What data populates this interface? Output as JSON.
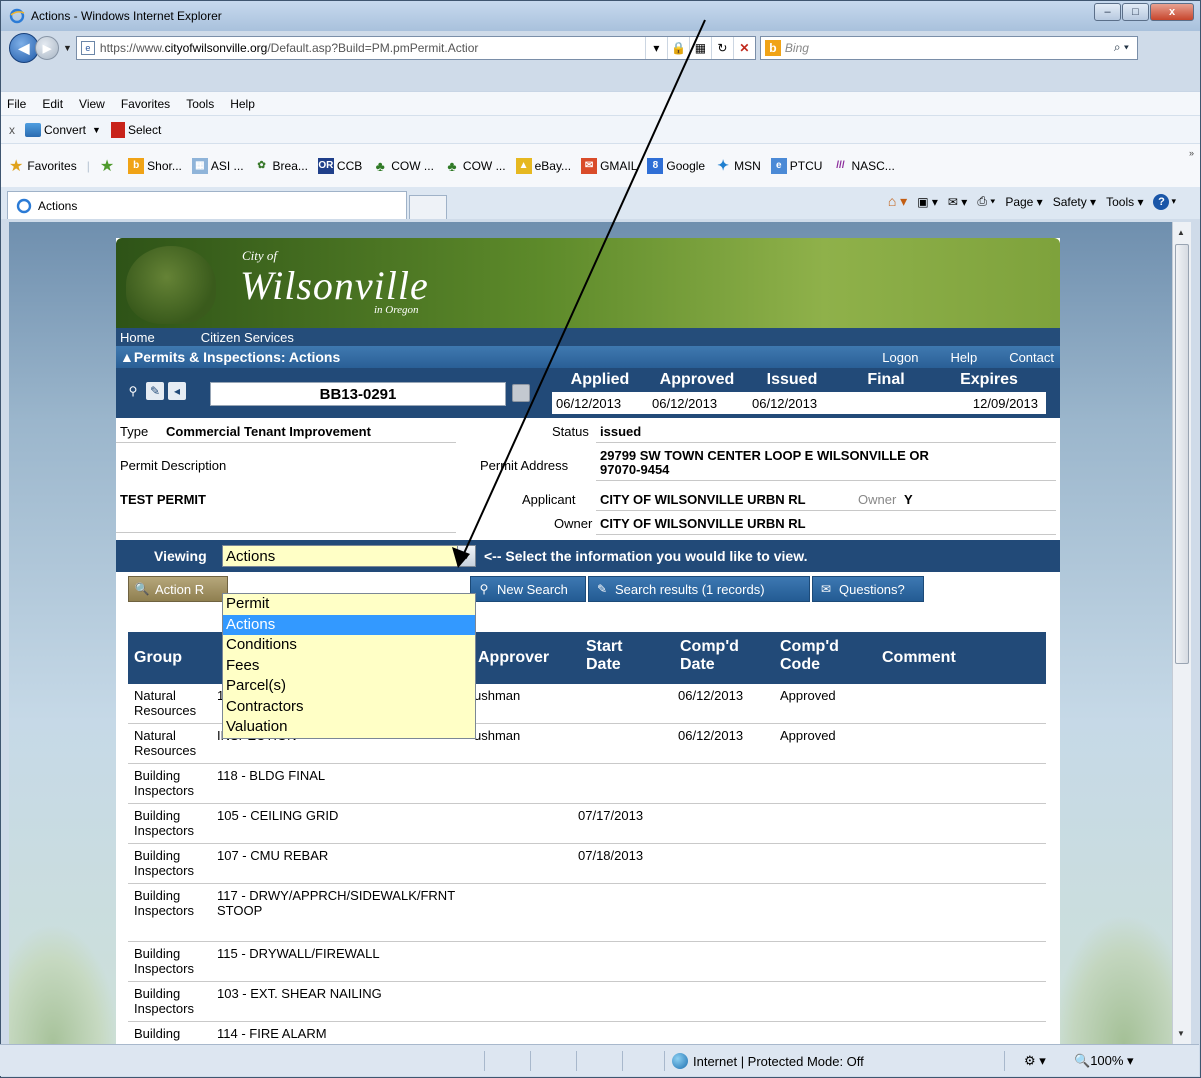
{
  "window": {
    "title": "Actions - Windows Internet Explorer",
    "min": "–",
    "max": "□",
    "close": "x"
  },
  "address": {
    "prefix": "https://www.",
    "domain": "cityofwilsonville.org",
    "path": "/Default.asp?Build=PM.pmPermit.Actior"
  },
  "search": {
    "placeholder": "Bing"
  },
  "menu": [
    "File",
    "Edit",
    "View",
    "Favorites",
    "Tools",
    "Help"
  ],
  "toolbar": {
    "close": "x",
    "convert": "Convert",
    "select": "Select"
  },
  "favorites": {
    "label": "Favorites",
    "items": [
      "Shor...",
      "ASI ...",
      "Brea...",
      "CCB",
      "COW ...",
      "COW ...",
      "eBay...",
      "GMAIL",
      "Google",
      "MSN",
      "PTCU",
      "NASC..."
    ]
  },
  "tab": {
    "label": "Actions"
  },
  "command": {
    "page": "Page ▾",
    "safety": "Safety ▾",
    "tools": "Tools ▾"
  },
  "site": {
    "city_of": "City of",
    "name": "Wilsonville",
    "in_oregon": "in Oregon",
    "nav": [
      "Home",
      "Citizen Services"
    ],
    "section": "▲Permits & Inspections: Actions",
    "links": [
      "Logon",
      "Help",
      "Contact"
    ]
  },
  "permit": {
    "number": "BB13-0291",
    "date_heads": [
      "Applied",
      "Approved",
      "Issued",
      "Final",
      "Expires"
    ],
    "date_vals": [
      "06/12/2013",
      "06/12/2013",
      "06/12/2013",
      "",
      "12/09/2013"
    ],
    "type_label": "Type",
    "type": "Commercial Tenant Improvement",
    "status_label": "Status",
    "status": "issued",
    "desc_label": "Permit Description",
    "address_label": "Permit Address",
    "address_l1": "29799 SW TOWN CENTER LOOP E WILSONVILLE OR",
    "address_l2": "97070-9454",
    "description": "TEST PERMIT",
    "applicant_label": "Applicant",
    "applicant": "CITY OF WILSONVILLE URBN RL",
    "owner_flag_label": "Owner",
    "owner_flag": "Y",
    "owner_label": "Owner",
    "owner": "CITY OF WILSONVILLE URBN RL"
  },
  "viewing": {
    "label": "Viewing",
    "selected": "Actions",
    "hint": "<-- Select the information you would like to view.",
    "options": [
      "Permit",
      "Actions",
      "Conditions",
      "Fees",
      "Parcel(s)",
      "Contractors",
      "Valuation"
    ],
    "selected_index": 1
  },
  "buttons": {
    "action": "Action R",
    "new_search": "New Search",
    "results": "Search results (1 records)",
    "questions": "Questions?"
  },
  "table": {
    "headers": [
      "Group",
      "Approver",
      "Start Date",
      "Comp'd Date",
      "Comp'd Code",
      "Comment"
    ],
    "rows": [
      {
        "group": "Natural Resources",
        "action": "1",
        "approver": "ushman",
        "start": "",
        "comp": "06/12/2013",
        "code": "Approved"
      },
      {
        "group": "Natural Resources",
        "action": "INSPECTION",
        "approver": "ushman",
        "start": "",
        "comp": "06/12/2013",
        "code": "Approved"
      },
      {
        "group": "Building Inspectors",
        "action": "118 - BLDG FINAL",
        "approver": "",
        "start": "",
        "comp": "",
        "code": ""
      },
      {
        "group": "Building Inspectors",
        "action": "105 - CEILING GRID",
        "approver": "",
        "start": "07/17/2013",
        "comp": "",
        "code": ""
      },
      {
        "group": "Building Inspectors",
        "action": "107 - CMU REBAR",
        "approver": "",
        "start": "07/18/2013",
        "comp": "",
        "code": ""
      },
      {
        "group": "Building Inspectors",
        "action": "117 - DRWY/APPRCH/SIDEWALK/FRNT STOOP",
        "approver": "",
        "start": "",
        "comp": "",
        "code": ""
      },
      {
        "group": "Building Inspectors",
        "action": "115 - DRYWALL/FIREWALL",
        "approver": "",
        "start": "",
        "comp": "",
        "code": ""
      },
      {
        "group": "Building Inspectors",
        "action": "103 - EXT. SHEAR NAILING",
        "approver": "",
        "start": "",
        "comp": "",
        "code": ""
      },
      {
        "group": "Building",
        "action": "114 - FIRE ALARM",
        "approver": "",
        "start": "",
        "comp": "",
        "code": ""
      }
    ]
  },
  "status": {
    "zone": "Internet | Protected Mode: Off",
    "zoom": "100%"
  },
  "colors": {
    "header_blue": "#224a78",
    "select_yellow": "#ffffc6",
    "selected_option": "#3399ff"
  }
}
